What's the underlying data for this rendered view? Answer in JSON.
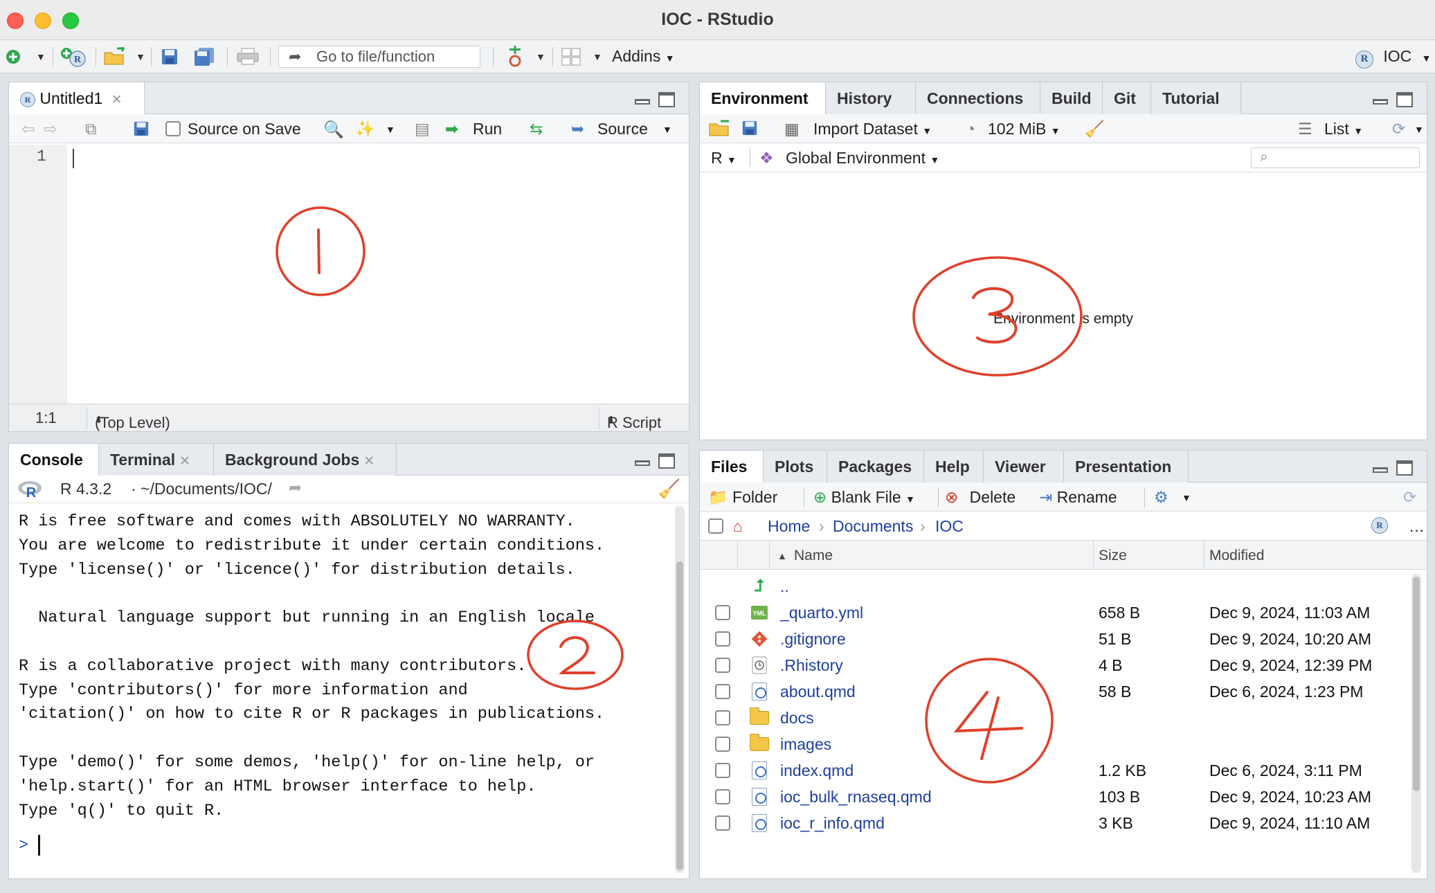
{
  "window": {
    "title": "IOC - RStudio"
  },
  "toolbar": {
    "goto_placeholder": "Go to file/function",
    "addins_label": "Addins",
    "project_label": "IOC"
  },
  "source": {
    "tab_label": "Untitled1",
    "source_on_save_label": "Source on Save",
    "run_label": "Run",
    "source_label": "Source",
    "line_number": "1",
    "status_position": "1:1",
    "status_scope": "(Top Level)",
    "status_filetype": "R Script"
  },
  "console": {
    "tabs": [
      "Console",
      "Terminal",
      "Background Jobs"
    ],
    "r_version": "R 4.3.2",
    "path": "· ~/Documents/IOC/",
    "lines": [
      "R is free software and comes with ABSOLUTELY NO WARRANTY.",
      "You are welcome to redistribute it under certain conditions.",
      "Type 'license()' or 'licence()' for distribution details.",
      "",
      "  Natural language support but running in an English locale",
      "",
      "R is a collaborative project with many contributors.",
      "Type 'contributors()' for more information and",
      "'citation()' on how to cite R or R packages in publications.",
      "",
      "Type 'demo()' for some demos, 'help()' for on-line help, or",
      "'help.start()' for an HTML browser interface to help.",
      "Type 'q()' to quit R."
    ],
    "prompt": ">"
  },
  "environment": {
    "tabs": [
      "Environment",
      "History",
      "Connections",
      "Build",
      "Git",
      "Tutorial"
    ],
    "import_label": "Import Dataset",
    "memory_label": "102 MiB",
    "view_label": "List",
    "lang_label": "R",
    "scope_label": "Global Environment",
    "empty_message": "Environment is empty"
  },
  "files": {
    "tabs": [
      "Files",
      "Plots",
      "Packages",
      "Help",
      "Viewer",
      "Presentation"
    ],
    "folder_label": "Folder",
    "blank_file_label": "Blank File",
    "delete_label": "Delete",
    "rename_label": "Rename",
    "breadcrumb": [
      "Home",
      "Documents",
      "IOC"
    ],
    "columns": {
      "name": "Name",
      "size": "Size",
      "modified": "Modified"
    },
    "parent_dir": "..",
    "rows": [
      {
        "name": "_quarto.yml",
        "size": "658 B",
        "modified": "Dec 9, 2024, 11:03 AM",
        "icon": "yml-file-icon"
      },
      {
        "name": ".gitignore",
        "size": "51 B",
        "modified": "Dec 9, 2024, 10:20 AM",
        "icon": "git-file-icon"
      },
      {
        "name": ".Rhistory",
        "size": "4 B",
        "modified": "Dec 9, 2024, 12:39 PM",
        "icon": "history-file-icon"
      },
      {
        "name": "about.qmd",
        "size": "58 B",
        "modified": "Dec 6, 2024, 1:23 PM",
        "icon": "qmd-file-icon"
      },
      {
        "name": "docs",
        "size": "",
        "modified": "",
        "icon": "folder-icon"
      },
      {
        "name": "images",
        "size": "",
        "modified": "",
        "icon": "folder-icon"
      },
      {
        "name": "index.qmd",
        "size": "1.2 KB",
        "modified": "Dec 6, 2024, 3:11 PM",
        "icon": "qmd-file-icon"
      },
      {
        "name": "ioc_bulk_rnaseq.qmd",
        "size": "103 B",
        "modified": "Dec 9, 2024, 10:23 AM",
        "icon": "qmd-file-icon"
      },
      {
        "name": "ioc_r_info.qmd",
        "size": "3 KB",
        "modified": "Dec 9, 2024, 11:10 AM",
        "icon": "qmd-file-icon"
      }
    ]
  },
  "colors": {
    "accent_red": "#e0402a",
    "link_blue": "#1e3fa0"
  }
}
